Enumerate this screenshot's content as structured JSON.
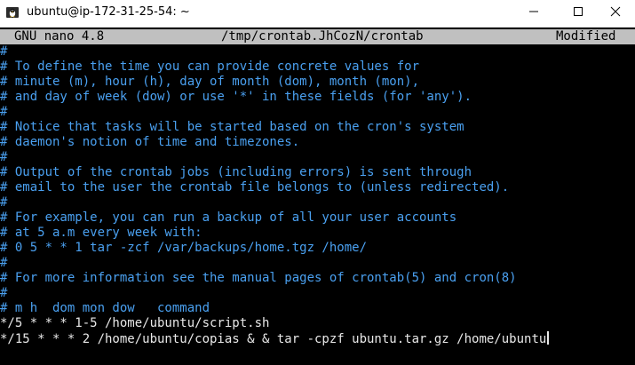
{
  "window": {
    "title": "ubuntu@ip-172-31-25-54: ~"
  },
  "nano": {
    "version": "GNU nano 4.8",
    "filename": "/tmp/crontab.JhCozN/crontab",
    "status": "Modified"
  },
  "editor": {
    "lines": [
      {
        "text": "#",
        "type": "comment"
      },
      {
        "text": "# To define the time you can provide concrete values for",
        "type": "comment"
      },
      {
        "text": "# minute (m), hour (h), day of month (dom), month (mon),",
        "type": "comment"
      },
      {
        "text": "# and day of week (dow) or use '*' in these fields (for 'any').",
        "type": "comment"
      },
      {
        "text": "#",
        "type": "comment"
      },
      {
        "text": "# Notice that tasks will be started based on the cron's system",
        "type": "comment"
      },
      {
        "text": "# daemon's notion of time and timezones.",
        "type": "comment"
      },
      {
        "text": "#",
        "type": "comment"
      },
      {
        "text": "# Output of the crontab jobs (including errors) is sent through",
        "type": "comment"
      },
      {
        "text": "# email to the user the crontab file belongs to (unless redirected).",
        "type": "comment"
      },
      {
        "text": "#",
        "type": "comment"
      },
      {
        "text": "# For example, you can run a backup of all your user accounts",
        "type": "comment"
      },
      {
        "text": "# at 5 a.m every week with:",
        "type": "comment"
      },
      {
        "text": "# 0 5 * * 1 tar -zcf /var/backups/home.tgz /home/",
        "type": "comment"
      },
      {
        "text": "#",
        "type": "comment"
      },
      {
        "text": "# For more information see the manual pages of crontab(5) and cron(8)",
        "type": "comment"
      },
      {
        "text": "#",
        "type": "comment"
      },
      {
        "text": "# m h  dom mon dow   command",
        "type": "comment"
      },
      {
        "text": "*/5 * * * 1-5 /home/ubuntu/script.sh",
        "type": "code"
      },
      {
        "text": "*/15 * * * 2 /home/ubuntu/copias & & tar -cpzf ubuntu.tar.gz /home/ubuntu",
        "type": "code"
      }
    ]
  },
  "icons": {
    "app": "terminal-penguin-icon",
    "minimize": "minimize-icon",
    "maximize": "maximize-icon",
    "close": "close-icon"
  },
  "colors": {
    "comment": "#4aa0f0",
    "code": "#e8e8e8",
    "header_bg": "#c0c0c0",
    "background": "#000000"
  }
}
